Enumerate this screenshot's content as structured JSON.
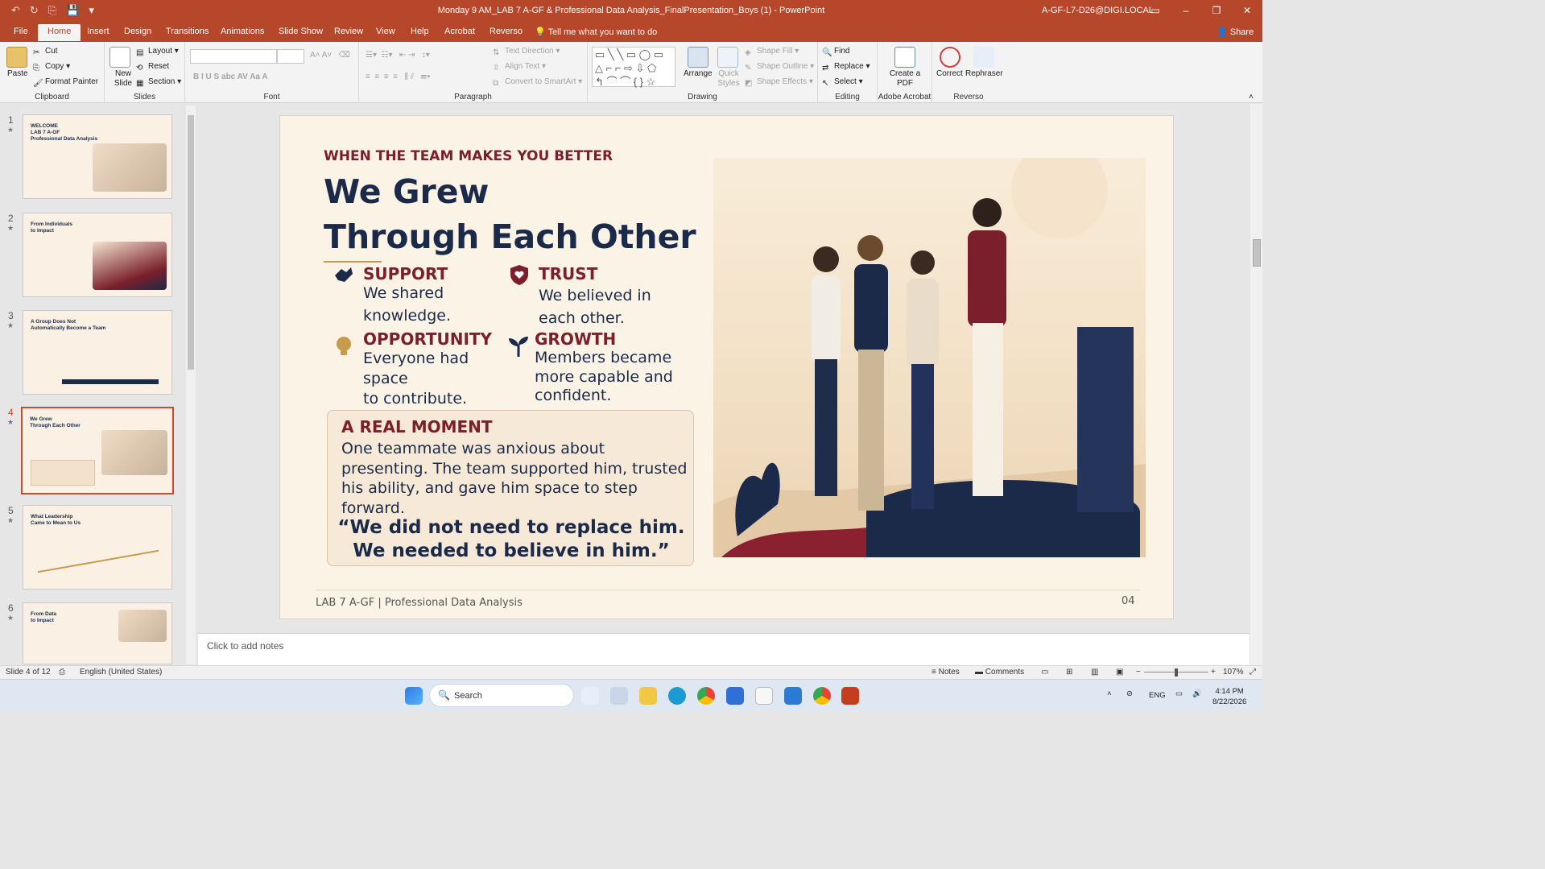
{
  "window": {
    "title": "Monday 9 AM_LAB 7 A-GF & Professional Data Analysis_FinalPresentation_Boys (1)  -  PowerPoint",
    "account": "A-GF-L7-D26@DIGI.LOCAL",
    "controls": [
      "▭",
      "–",
      "❐",
      "✕"
    ]
  },
  "qat": [
    "↶",
    "↻",
    "⎘",
    "💾",
    "▾"
  ],
  "tabs": [
    "File",
    "Home",
    "Insert",
    "Design",
    "Transitions",
    "Animations",
    "Slide Show",
    "Review",
    "View",
    "Help",
    "Acrobat",
    "Reverso"
  ],
  "tell_me": "Tell me what you want to do",
  "share": "Share",
  "ribbon": {
    "clipboard": {
      "label": "Clipboard",
      "paste": "Paste",
      "cut": "Cut",
      "copy": "Copy",
      "format_painter": "Format Painter"
    },
    "slides": {
      "label": "Slides",
      "new_slide": "New Slide",
      "layout": "Layout",
      "reset": "Reset",
      "section": "Section"
    },
    "font": {
      "label": "Font",
      "buttons": "B   I   U   S   abc  AV   Aa      A"
    },
    "paragraph": {
      "label": "Paragraph",
      "text_direction": "Text Direction",
      "align_text": "Align Text",
      "convert": "Convert to SmartArt"
    },
    "drawing": {
      "label": "Drawing",
      "arrange": "Arrange",
      "quick_styles": "Quick Styles",
      "shape_fill": "Shape Fill",
      "shape_outline": "Shape Outline",
      "shape_effects": "Shape Effects"
    },
    "editing": {
      "label": "Editing",
      "find": "Find",
      "replace": "Replace",
      "select": "Select"
    },
    "acrobat": {
      "label": "Adobe Acrobat",
      "create_pdf": "Create a PDF"
    },
    "reverso": {
      "label": "Reverso",
      "correct": "Correct",
      "rephraser": "Rephraser"
    }
  },
  "thumbnails": [
    {
      "num": "1",
      "title": "WELCOME\nLAB 7 A-GF\nProfessional Data Analysis"
    },
    {
      "num": "2",
      "title": "From Individuals\nto Impact"
    },
    {
      "num": "3",
      "title": "A Group Does Not\nAutomatically Become a Team"
    },
    {
      "num": "4",
      "title": "We Grew\nThrough Each Other"
    },
    {
      "num": "5",
      "title": "What Leadership\nCame to Mean to Us"
    },
    {
      "num": "6",
      "title": "From Data\nto Impact"
    }
  ],
  "slide": {
    "kicker": "WHEN THE TEAM MAKES YOU BETTER",
    "title_line1": "We Grew",
    "title_line2": "Through Each Other",
    "support_h": "SUPPORT",
    "support_b1": "We shared",
    "support_b2": "knowledge.",
    "trust_h": "TRUST",
    "trust_b1": "We believed in",
    "trust_b2": "each other.",
    "opp_h": "OPPORTUNITY",
    "opp_b1": "Everyone had",
    "opp_b2": "space",
    "opp_b3": "to contribute.",
    "growth_h": "GROWTH",
    "growth_b1": "Members became",
    "growth_b2": "more capable and",
    "growth_b3": "confident.",
    "moment_h": "A REAL MOMENT",
    "moment_b": "One teammate was anxious about presenting. The team supported him, trusted his ability, and gave him space to step forward.",
    "quote1": "“We did not need to replace him.",
    "quote2": "We needed to believe in him.”",
    "footer": "LAB 7 A-GF  |  Professional Data Analysis",
    "page": "04"
  },
  "notes_placeholder": "Click to add notes",
  "status": {
    "slide": "Slide 4 of 12",
    "language": "English (United States)",
    "notes": "Notes",
    "comments": "Comments",
    "zoom": "107%"
  },
  "taskbar": {
    "search": "Search",
    "lang": "ENG",
    "time": "4:14 PM",
    "date": "8/22/2026"
  },
  "colors": {
    "accent": "#b7472a",
    "maroon": "#7a1f2b",
    "navy": "#1b2a49",
    "gold": "#c79a4c"
  }
}
